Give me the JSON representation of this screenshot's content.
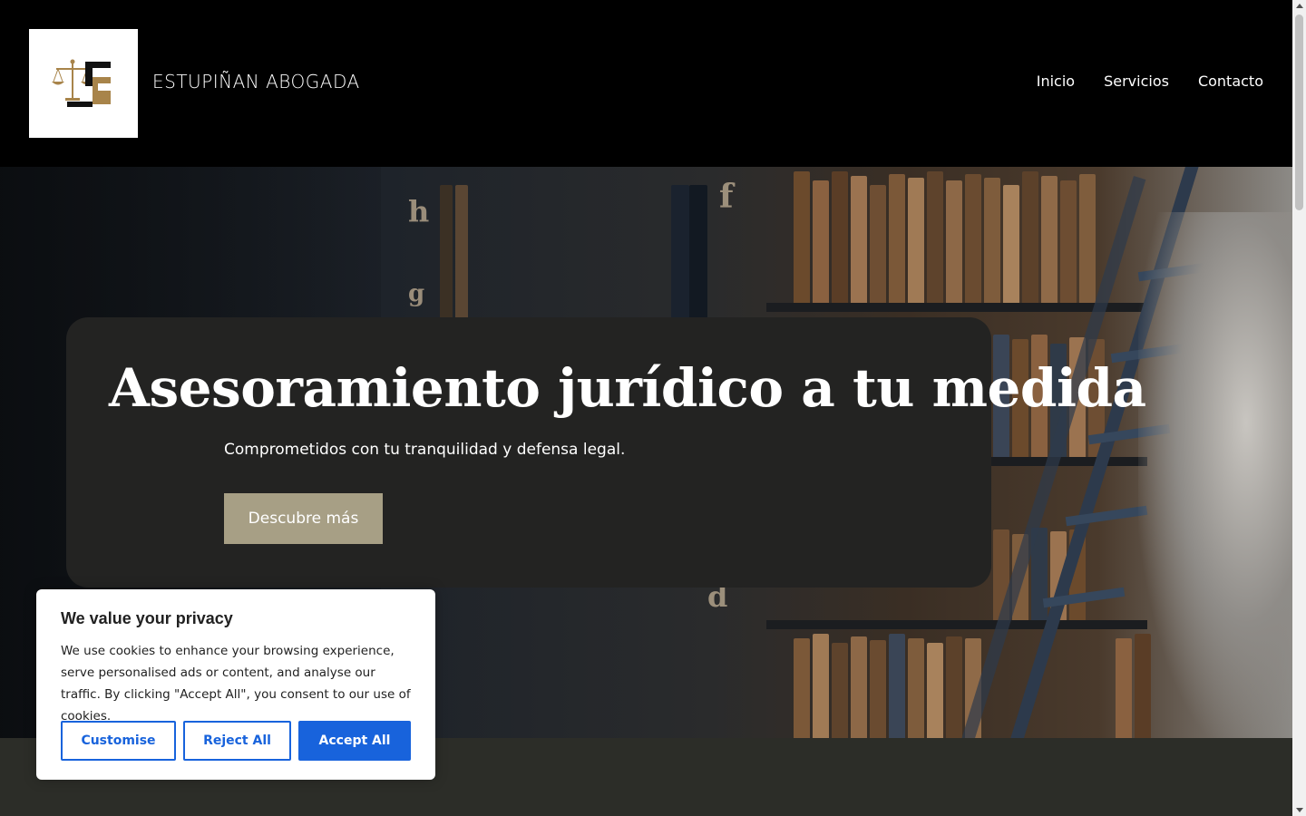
{
  "header": {
    "site_title": "ESTUPIÑAN ABOGADA",
    "nav": [
      {
        "label": "Inicio"
      },
      {
        "label": "Servicios"
      },
      {
        "label": "Contacto"
      }
    ]
  },
  "hero": {
    "title": "Asesoramiento jurídico a tu medida",
    "subtitle": "Comprometidos con tu tranquilidad y defensa legal.",
    "button_label": "Descubre más",
    "button_color": "#a79f85"
  },
  "cookie": {
    "title": "We value your privacy",
    "text": "We use cookies to enhance your browsing experience, serve personalised ads or content, and analyse our traffic. By clicking \"Accept All\", you consent to our use of cookies.",
    "customise_label": "Customise",
    "reject_label": "Reject All",
    "accept_label": "Accept All",
    "accent_color": "#1863dc"
  },
  "colors": {
    "header_bg": "#000000",
    "card_bg": "#232322",
    "lower_bg": "#2c2d28",
    "logo_gold": "#a8844a"
  }
}
